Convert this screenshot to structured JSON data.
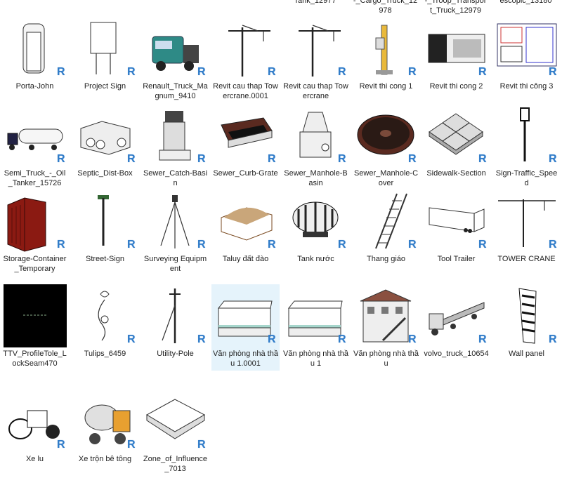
{
  "partial_row": [
    {
      "col": 4,
      "label": "Tank_12977"
    },
    {
      "col": 5,
      "label": "-_Cargo_Truck_12 978"
    },
    {
      "col": 6,
      "label": "-_Troop_Transpor t_Truck_12979"
    },
    {
      "col": 7,
      "label": "escopic_13180"
    }
  ],
  "badge_text": "R",
  "colors": {
    "badge": "#2f7bc8",
    "selected_bg": "#e5f3fb"
  },
  "rows": [
    [
      {
        "label": "Porta-John",
        "icon": "portable-toilet"
      },
      {
        "label": "Project Sign",
        "icon": "sign-board"
      },
      {
        "label": "Renault_Truck_Magnum_9410",
        "icon": "truck"
      },
      {
        "label": "Revit cau thap Towercrane.0001",
        "icon": "tower-crane"
      },
      {
        "label": "Revit cau thap Towercrane",
        "icon": "tower-crane"
      },
      {
        "label": "Revit thi cong 1",
        "icon": "hoist"
      },
      {
        "label": "Revit thi cong 2",
        "icon": "site-render"
      },
      {
        "label": "Revit thi công 3",
        "icon": "drawing-sheet"
      }
    ],
    [
      {
        "label": "Semi_Truck_-_Oil_Tanker_15726",
        "icon": "tanker-truck"
      },
      {
        "label": "Septic_Dist-Box",
        "icon": "septic-box"
      },
      {
        "label": "Sewer_Catch-Basin",
        "icon": "catch-basin"
      },
      {
        "label": "Sewer_Curb-Grate",
        "icon": "curb-grate"
      },
      {
        "label": "Sewer_Manhole-Basin",
        "icon": "manhole-basin"
      },
      {
        "label": "Sewer_Manhole-Cover",
        "icon": "manhole-cover"
      },
      {
        "label": "Sidewalk-Section",
        "icon": "sidewalk"
      },
      {
        "label": "Sign-Traffic_Speed",
        "icon": "traffic-sign"
      }
    ],
    [
      {
        "label": "Storage-Container_Temporary",
        "icon": "container"
      },
      {
        "label": "Street-Sign",
        "icon": "street-sign"
      },
      {
        "label": "Surveying Equipment",
        "icon": "tripod"
      },
      {
        "label": "Taluy đất đào",
        "icon": "soil"
      },
      {
        "label": "Tank nước",
        "icon": "water-tank"
      },
      {
        "label": "Thang giáo",
        "icon": "ladder"
      },
      {
        "label": "Tool Trailer",
        "icon": "trailer"
      },
      {
        "label": "TOWER CRANE",
        "icon": "tower-crane-flat"
      }
    ],
    [
      {
        "label": "TTV_ProfileTole_LockSeam470",
        "icon": "black-thumbnail"
      },
      {
        "label": "Tulips_6459",
        "icon": "tulip-lamp"
      },
      {
        "label": "Utility-Pole",
        "icon": "utility-pole"
      },
      {
        "label": "Văn phòng nhà thầu 1.0001",
        "icon": "office-cabin",
        "selected": true
      },
      {
        "label": "Văn phòng nhà thầu 1",
        "icon": "office-cabin"
      },
      {
        "label": "Văn phòng nhà thầu",
        "icon": "building"
      },
      {
        "label": "volvo_truck_10654",
        "icon": "flatbed-truck"
      },
      {
        "label": "Wall panel",
        "icon": "wall-panel"
      }
    ],
    [
      {
        "label": "Xe lu",
        "icon": "road-roller"
      },
      {
        "label": "Xe trộn bê tông",
        "icon": "concrete-mixer"
      },
      {
        "label": "Zone_of_Influence_7013",
        "icon": "pyramid"
      }
    ]
  ]
}
